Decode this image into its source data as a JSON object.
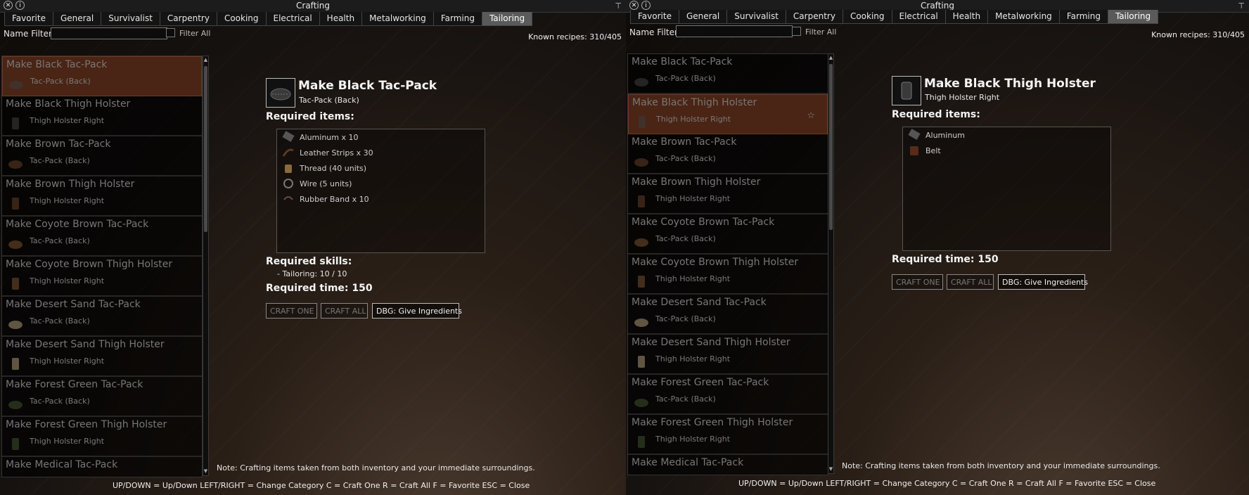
{
  "window": {
    "title": "Crafting",
    "close_icon": "✕",
    "info_icon": "i",
    "pin_icon": "⊤"
  },
  "tabs": [
    "Favorite",
    "General",
    "Survivalist",
    "Carpentry",
    "Cooking",
    "Electrical",
    "Health",
    "Metalworking",
    "Farming",
    "Tailoring"
  ],
  "active_tab": "Tailoring",
  "filter": {
    "label": "Name Filter:",
    "value": "",
    "filter_all_label": "Filter All"
  },
  "known_recipes": "Known recipes:  310/405",
  "recipes": [
    {
      "title": "Make Black Tac-Pack",
      "sub": "Tac-Pack (Back)",
      "icon": "pack",
      "color": "#3a3a3a"
    },
    {
      "title": "Make Black Thigh Holster",
      "sub": "Thigh Holster Right",
      "icon": "holster",
      "color": "#3a3a3a"
    },
    {
      "title": "Make Brown Tac-Pack",
      "sub": "Tac-Pack (Back)",
      "icon": "pack",
      "color": "#5a3a22"
    },
    {
      "title": "Make Brown Thigh Holster",
      "sub": "Thigh Holster Right",
      "icon": "holster",
      "color": "#5a3a22"
    },
    {
      "title": "Make Coyote Brown Tac-Pack",
      "sub": "Tac-Pack (Back)",
      "icon": "pack",
      "color": "#6a4a2a"
    },
    {
      "title": "Make Coyote Brown Thigh Holster",
      "sub": "Thigh Holster Right",
      "icon": "holster",
      "color": "#6a4a2a"
    },
    {
      "title": "Make Desert Sand Tac-Pack",
      "sub": "Tac-Pack (Back)",
      "icon": "pack",
      "color": "#9a8a6a"
    },
    {
      "title": "Make Desert Sand Thigh Holster",
      "sub": "Thigh Holster Right",
      "icon": "holster",
      "color": "#9a8a6a"
    },
    {
      "title": "Make Forest Green Tac-Pack",
      "sub": "Tac-Pack (Back)",
      "icon": "pack",
      "color": "#3a4a2a"
    },
    {
      "title": "Make Forest Green Thigh Holster",
      "sub": "Thigh Holster Right",
      "icon": "holster",
      "color": "#3a4a2a"
    },
    {
      "title": "Make Medical Tac-Pack",
      "sub": "",
      "icon": "pack",
      "color": "#3a3a3a"
    }
  ],
  "left_detail": {
    "title": "Make Black Tac-Pack",
    "sub": "Tac-Pack (Back)",
    "required_items_label": "Required items:",
    "items": [
      {
        "label": "Aluminum x 10",
        "icon": "aluminum"
      },
      {
        "label": "Leather Strips x 30",
        "icon": "leather"
      },
      {
        "label": "Thread (40 units)",
        "icon": "thread"
      },
      {
        "label": "Wire (5 units)",
        "icon": "wire"
      },
      {
        "label": "Rubber Band x 10",
        "icon": "rubber-band"
      }
    ],
    "required_skills_label": "Required skills:",
    "skill": "- Tailoring: 10 / 10",
    "required_time": "Required time: 150"
  },
  "right_detail": {
    "title": "Make Black Thigh Holster",
    "sub": "Thigh Holster Right",
    "required_items_label": "Required items:",
    "items": [
      {
        "label": "Aluminum",
        "icon": "aluminum"
      },
      {
        "label": "Belt",
        "icon": "belt"
      }
    ],
    "required_time": "Required time: 150"
  },
  "buttons": {
    "craft_one": "CRAFT ONE",
    "craft_all": "CRAFT ALL",
    "dbg": "DBG: Give Ingredients"
  },
  "favorite_icon": "☆",
  "scroll": {
    "up": "▲",
    "down": "▼"
  },
  "note": "Note: Crafting items taken from both inventory and your immediate surroundings.",
  "help": "UP/DOWN = Up/Down    LEFT/RIGHT = Change Category    C = Craft One    R = Craft All    F = Favorite    ESC = Close"
}
